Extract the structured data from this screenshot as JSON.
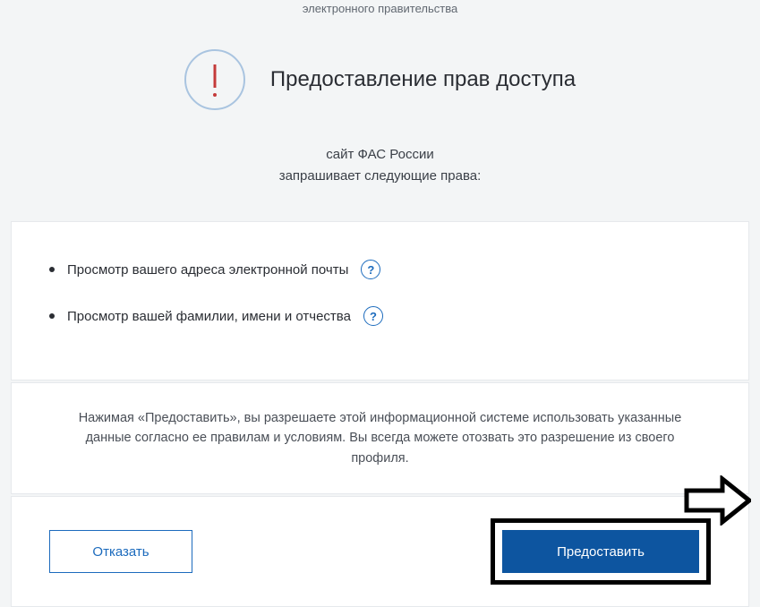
{
  "header": {
    "top_text": "электронного правительства",
    "title": "Предоставление прав доступа"
  },
  "subtitle": {
    "line1": "сайт ФАС России",
    "line2": "запрашивает следующие права:"
  },
  "permissions": [
    {
      "label": "Просмотр вашего адреса электронной почты"
    },
    {
      "label": "Просмотр вашей фамилии, имени и отчества"
    }
  ],
  "disclaimer": "Нажимая «Предоставить», вы разрешаете этой информационной системе использовать указанные данные согласно ее правилам и условиям. Вы всегда можете отозвать это разрешение из своего профиля.",
  "actions": {
    "deny_label": "Отказать",
    "grant_label": "Предоставить"
  }
}
